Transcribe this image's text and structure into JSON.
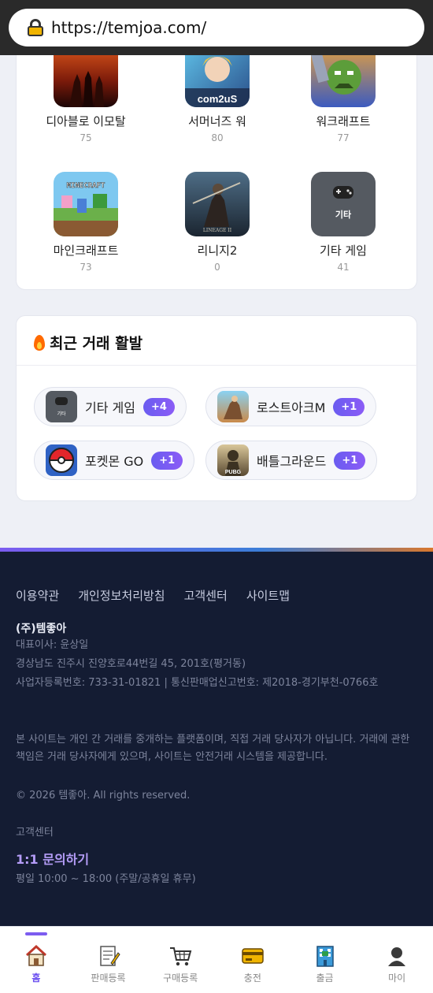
{
  "browser": {
    "url": "https://temjoa.com/"
  },
  "games": {
    "items": [
      {
        "name": "디아블로 이모탈",
        "count": "75",
        "icon": "diablo-immortal-icon"
      },
      {
        "name": "서머너즈 워",
        "count": "80",
        "icon": "summoners-war-icon",
        "icon_text": "com2uS"
      },
      {
        "name": "워크래프트",
        "count": "77",
        "icon": "warcraft-icon"
      },
      {
        "name": "마인크래프트",
        "count": "73",
        "icon": "minecraft-icon",
        "icon_text": "MINECRAFT"
      },
      {
        "name": "리니지2",
        "count": "0",
        "icon": "lineage2-icon"
      },
      {
        "name": "기타 게임",
        "count": "41",
        "icon": "gamepad-icon",
        "icon_text": "기타"
      }
    ]
  },
  "activity": {
    "title": "최근 거래 활발",
    "items": [
      {
        "label": "기타 게임",
        "badge": "+4",
        "icon": "gamepad-icon",
        "icon_text": "기타"
      },
      {
        "label": "로스트아크M",
        "badge": "+1",
        "icon": "lost-ark-m-icon"
      },
      {
        "label": "포켓몬 GO",
        "badge": "+1",
        "icon": "pokeball-icon"
      },
      {
        "label": "배틀그라운드",
        "badge": "+1",
        "icon": "pubg-icon",
        "icon_text": "PUBG"
      }
    ]
  },
  "footer": {
    "links": [
      "이용약관",
      "개인정보처리방침",
      "고객센터",
      "사이트맵"
    ],
    "company": "(주)템좋아",
    "ceo": "대표이사: 윤상일",
    "address": "경상남도 진주시 진양호로44번길 45, 201호(평거동)",
    "registration": "사업자등록번호: 733-31-01821 | 통신판매업신고번호: 제2018-경기부천-0766호",
    "disclaimer": "본 사이트는 개인 간 거래를 중개하는 플랫폼이며, 직접 거래 당사자가 아닙니다. 거래에 관한 책임은 거래 당사자에게 있으며, 사이트는 안전거래 시스템을 제공합니다.",
    "copyright": "© 2026 템좋아. All rights reserved.",
    "cs_label": "고객센터",
    "cs_link": "1:1 문의하기",
    "cs_hours": "평일 10:00 ~ 18:00 (주말/공휴일 휴무)"
  },
  "nav": {
    "items": [
      {
        "label": "홈",
        "icon": "home-icon",
        "active": true
      },
      {
        "label": "판매등록",
        "icon": "memo-icon"
      },
      {
        "label": "구매등록",
        "icon": "cart-icon"
      },
      {
        "label": "충전",
        "icon": "credit-card-icon"
      },
      {
        "label": "출금",
        "icon": "bank-icon"
      },
      {
        "label": "마이",
        "icon": "user-icon"
      }
    ]
  },
  "colors": {
    "accent": "#7c5cf0",
    "footer_bg": "#141c33",
    "badge": "#6a5cf0"
  }
}
